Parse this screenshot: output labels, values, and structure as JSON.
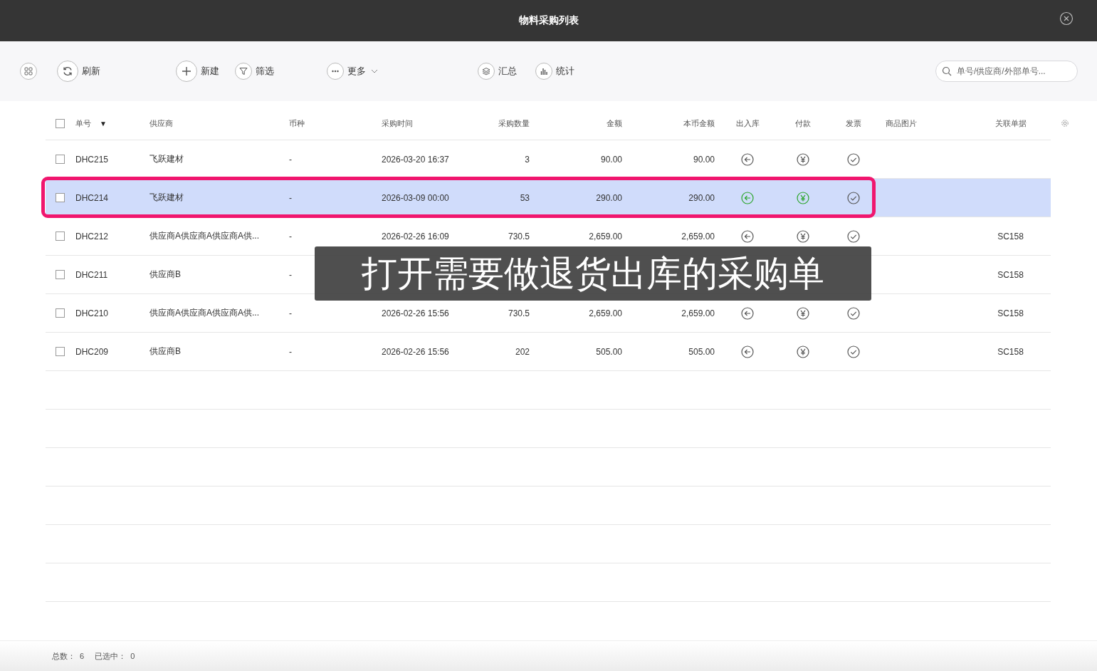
{
  "window": {
    "title": "物料采购列表"
  },
  "toolbar": {
    "buttons": [
      {
        "label": "刷新",
        "has_menu": false
      },
      {
        "label": "新建",
        "has_menu": false
      },
      {
        "label": "筛选",
        "has_menu": false
      },
      {
        "label": "更多",
        "has_menu": true
      },
      {
        "label": "汇总",
        "has_menu": false
      },
      {
        "label": "统计",
        "has_menu": false
      }
    ],
    "search": {
      "placeholder": "单号/供应商/外部单号..."
    }
  },
  "table": {
    "header_checked": false,
    "sort_indicator": "▼",
    "columns": [
      "单号",
      "供应商",
      "币种",
      "采购时间",
      "采购数量",
      "金额",
      "本币金额",
      "出入库",
      "付款",
      "发票",
      "商品图片",
      "关联单据"
    ],
    "rows": [
      {
        "checked": false,
        "selected": false,
        "framed": false,
        "number": "DHC215",
        "supplier": "飞跃建材",
        "currency": "-",
        "time": "2026-03-20 16:37",
        "quantity": "3",
        "amount": "90.00",
        "base_amount": "90.00",
        "stock_active": false,
        "payment_active": false,
        "invoice_active": false,
        "related": ""
      },
      {
        "checked": false,
        "selected": true,
        "framed": true,
        "number": "DHC214",
        "supplier": "飞跃建材",
        "currency": "-",
        "time": "2026-03-09 00:00",
        "quantity": "53",
        "amount": "290.00",
        "base_amount": "290.00",
        "stock_active": true,
        "payment_active": true,
        "invoice_active": false,
        "related": ""
      },
      {
        "checked": false,
        "selected": false,
        "framed": false,
        "number": "DHC212",
        "supplier": "供应商A供应商A供应商A供...",
        "currency": "-",
        "time": "2026-02-26 16:09",
        "quantity": "730.5",
        "amount": "2,659.00",
        "base_amount": "2,659.00",
        "stock_active": false,
        "payment_active": false,
        "invoice_active": false,
        "related": "SC158"
      },
      {
        "checked": false,
        "selected": false,
        "framed": false,
        "number": "DHC211",
        "supplier": "供应商B",
        "currency": "-",
        "related": "SC158"
      },
      {
        "checked": false,
        "selected": false,
        "framed": false,
        "number": "DHC210",
        "supplier": "供应商A供应商A供应商A供...",
        "currency": "-",
        "time": "2026-02-26 15:56",
        "quantity": "730.5",
        "amount": "2,659.00",
        "base_amount": "2,659.00",
        "stock_active": false,
        "payment_active": false,
        "invoice_active": false,
        "related": "SC158"
      },
      {
        "checked": false,
        "selected": false,
        "framed": false,
        "number": "DHC209",
        "supplier": "供应商B",
        "currency": "-",
        "time": "2026-02-26 15:56",
        "quantity": "202",
        "amount": "505.00",
        "base_amount": "505.00",
        "stock_active": false,
        "payment_active": false,
        "invoice_active": false,
        "related": "SC158"
      }
    ]
  },
  "caption": "打开需要做退货出库的采购单",
  "footer": {
    "total_label": "总数：",
    "total": "6",
    "selected_label": "已选中：",
    "selected": "0"
  }
}
